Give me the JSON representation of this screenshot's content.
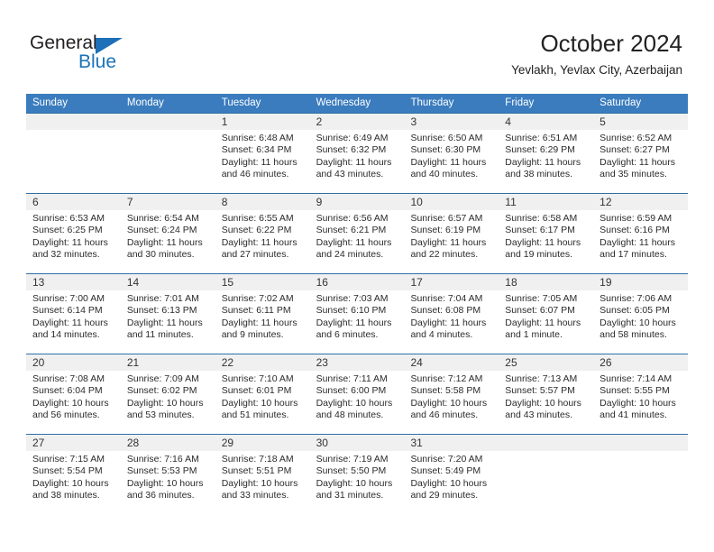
{
  "logo": {
    "word_top": "General",
    "word_bottom": "Blue",
    "triangle_icon": "triangle-icon",
    "colors": {
      "dark": "#231f20",
      "blue": "#1a73b7"
    }
  },
  "header": {
    "title": "October 2024",
    "subtitle": "Yevlakh, Yevlax City, Azerbaijan"
  },
  "colors": {
    "header_row_background": "#3a7cbe",
    "header_row_text": "#ffffff",
    "row_divider": "#2f6fa8",
    "date_band": "#f0f0f0"
  },
  "weekdays": [
    "Sunday",
    "Monday",
    "Tuesday",
    "Wednesday",
    "Thursday",
    "Friday",
    "Saturday"
  ],
  "weeks": [
    [
      {
        "empty": true
      },
      {
        "empty": true
      },
      {
        "day": "1",
        "sunrise": "Sunrise: 6:48 AM",
        "sunset": "Sunset: 6:34 PM",
        "daylight1": "Daylight: 11 hours",
        "daylight2": "and 46 minutes."
      },
      {
        "day": "2",
        "sunrise": "Sunrise: 6:49 AM",
        "sunset": "Sunset: 6:32 PM",
        "daylight1": "Daylight: 11 hours",
        "daylight2": "and 43 minutes."
      },
      {
        "day": "3",
        "sunrise": "Sunrise: 6:50 AM",
        "sunset": "Sunset: 6:30 PM",
        "daylight1": "Daylight: 11 hours",
        "daylight2": "and 40 minutes."
      },
      {
        "day": "4",
        "sunrise": "Sunrise: 6:51 AM",
        "sunset": "Sunset: 6:29 PM",
        "daylight1": "Daylight: 11 hours",
        "daylight2": "and 38 minutes."
      },
      {
        "day": "5",
        "sunrise": "Sunrise: 6:52 AM",
        "sunset": "Sunset: 6:27 PM",
        "daylight1": "Daylight: 11 hours",
        "daylight2": "and 35 minutes."
      }
    ],
    [
      {
        "day": "6",
        "sunrise": "Sunrise: 6:53 AM",
        "sunset": "Sunset: 6:25 PM",
        "daylight1": "Daylight: 11 hours",
        "daylight2": "and 32 minutes."
      },
      {
        "day": "7",
        "sunrise": "Sunrise: 6:54 AM",
        "sunset": "Sunset: 6:24 PM",
        "daylight1": "Daylight: 11 hours",
        "daylight2": "and 30 minutes."
      },
      {
        "day": "8",
        "sunrise": "Sunrise: 6:55 AM",
        "sunset": "Sunset: 6:22 PM",
        "daylight1": "Daylight: 11 hours",
        "daylight2": "and 27 minutes."
      },
      {
        "day": "9",
        "sunrise": "Sunrise: 6:56 AM",
        "sunset": "Sunset: 6:21 PM",
        "daylight1": "Daylight: 11 hours",
        "daylight2": "and 24 minutes."
      },
      {
        "day": "10",
        "sunrise": "Sunrise: 6:57 AM",
        "sunset": "Sunset: 6:19 PM",
        "daylight1": "Daylight: 11 hours",
        "daylight2": "and 22 minutes."
      },
      {
        "day": "11",
        "sunrise": "Sunrise: 6:58 AM",
        "sunset": "Sunset: 6:17 PM",
        "daylight1": "Daylight: 11 hours",
        "daylight2": "and 19 minutes."
      },
      {
        "day": "12",
        "sunrise": "Sunrise: 6:59 AM",
        "sunset": "Sunset: 6:16 PM",
        "daylight1": "Daylight: 11 hours",
        "daylight2": "and 17 minutes."
      }
    ],
    [
      {
        "day": "13",
        "sunrise": "Sunrise: 7:00 AM",
        "sunset": "Sunset: 6:14 PM",
        "daylight1": "Daylight: 11 hours",
        "daylight2": "and 14 minutes."
      },
      {
        "day": "14",
        "sunrise": "Sunrise: 7:01 AM",
        "sunset": "Sunset: 6:13 PM",
        "daylight1": "Daylight: 11 hours",
        "daylight2": "and 11 minutes."
      },
      {
        "day": "15",
        "sunrise": "Sunrise: 7:02 AM",
        "sunset": "Sunset: 6:11 PM",
        "daylight1": "Daylight: 11 hours",
        "daylight2": "and 9 minutes."
      },
      {
        "day": "16",
        "sunrise": "Sunrise: 7:03 AM",
        "sunset": "Sunset: 6:10 PM",
        "daylight1": "Daylight: 11 hours",
        "daylight2": "and 6 minutes."
      },
      {
        "day": "17",
        "sunrise": "Sunrise: 7:04 AM",
        "sunset": "Sunset: 6:08 PM",
        "daylight1": "Daylight: 11 hours",
        "daylight2": "and 4 minutes."
      },
      {
        "day": "18",
        "sunrise": "Sunrise: 7:05 AM",
        "sunset": "Sunset: 6:07 PM",
        "daylight1": "Daylight: 11 hours",
        "daylight2": "and 1 minute."
      },
      {
        "day": "19",
        "sunrise": "Sunrise: 7:06 AM",
        "sunset": "Sunset: 6:05 PM",
        "daylight1": "Daylight: 10 hours",
        "daylight2": "and 58 minutes."
      }
    ],
    [
      {
        "day": "20",
        "sunrise": "Sunrise: 7:08 AM",
        "sunset": "Sunset: 6:04 PM",
        "daylight1": "Daylight: 10 hours",
        "daylight2": "and 56 minutes."
      },
      {
        "day": "21",
        "sunrise": "Sunrise: 7:09 AM",
        "sunset": "Sunset: 6:02 PM",
        "daylight1": "Daylight: 10 hours",
        "daylight2": "and 53 minutes."
      },
      {
        "day": "22",
        "sunrise": "Sunrise: 7:10 AM",
        "sunset": "Sunset: 6:01 PM",
        "daylight1": "Daylight: 10 hours",
        "daylight2": "and 51 minutes."
      },
      {
        "day": "23",
        "sunrise": "Sunrise: 7:11 AM",
        "sunset": "Sunset: 6:00 PM",
        "daylight1": "Daylight: 10 hours",
        "daylight2": "and 48 minutes."
      },
      {
        "day": "24",
        "sunrise": "Sunrise: 7:12 AM",
        "sunset": "Sunset: 5:58 PM",
        "daylight1": "Daylight: 10 hours",
        "daylight2": "and 46 minutes."
      },
      {
        "day": "25",
        "sunrise": "Sunrise: 7:13 AM",
        "sunset": "Sunset: 5:57 PM",
        "daylight1": "Daylight: 10 hours",
        "daylight2": "and 43 minutes."
      },
      {
        "day": "26",
        "sunrise": "Sunrise: 7:14 AM",
        "sunset": "Sunset: 5:55 PM",
        "daylight1": "Daylight: 10 hours",
        "daylight2": "and 41 minutes."
      }
    ],
    [
      {
        "day": "27",
        "sunrise": "Sunrise: 7:15 AM",
        "sunset": "Sunset: 5:54 PM",
        "daylight1": "Daylight: 10 hours",
        "daylight2": "and 38 minutes."
      },
      {
        "day": "28",
        "sunrise": "Sunrise: 7:16 AM",
        "sunset": "Sunset: 5:53 PM",
        "daylight1": "Daylight: 10 hours",
        "daylight2": "and 36 minutes."
      },
      {
        "day": "29",
        "sunrise": "Sunrise: 7:18 AM",
        "sunset": "Sunset: 5:51 PM",
        "daylight1": "Daylight: 10 hours",
        "daylight2": "and 33 minutes."
      },
      {
        "day": "30",
        "sunrise": "Sunrise: 7:19 AM",
        "sunset": "Sunset: 5:50 PM",
        "daylight1": "Daylight: 10 hours",
        "daylight2": "and 31 minutes."
      },
      {
        "day": "31",
        "sunrise": "Sunrise: 7:20 AM",
        "sunset": "Sunset: 5:49 PM",
        "daylight1": "Daylight: 10 hours",
        "daylight2": "and 29 minutes."
      },
      {
        "empty": true
      },
      {
        "empty": true
      }
    ]
  ]
}
